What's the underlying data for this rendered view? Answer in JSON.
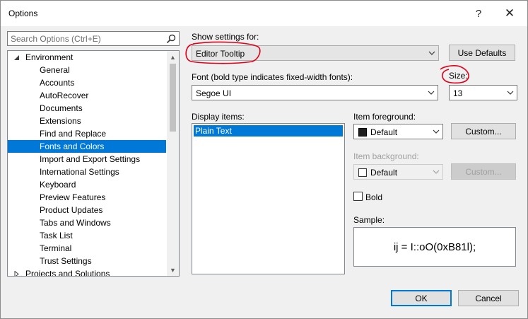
{
  "window": {
    "title": "Options",
    "help_glyph": "?",
    "close_glyph": "✕"
  },
  "search": {
    "placeholder": "Search Options (Ctrl+E)"
  },
  "tree": {
    "root_label": "Environment",
    "children": [
      "General",
      "Accounts",
      "AutoRecover",
      "Documents",
      "Extensions",
      "Find and Replace",
      "Fonts and Colors",
      "Import and Export Settings",
      "International Settings",
      "Keyboard",
      "Preview Features",
      "Product Updates",
      "Tabs and Windows",
      "Task List",
      "Terminal",
      "Trust Settings"
    ],
    "selected": "Fonts and Colors",
    "next_root_label": "Projects and Solutions"
  },
  "settings": {
    "show_settings_label": "Show settings for:",
    "show_settings_value": "Editor Tooltip",
    "use_defaults_label": "Use Defaults",
    "font_label": "Font (bold type indicates fixed-width fonts):",
    "font_value": "Segoe UI",
    "size_label": "Size:",
    "size_value": "13",
    "display_items_label": "Display items:",
    "display_items": [
      "Plain Text"
    ],
    "item_foreground_label": "Item foreground:",
    "item_foreground_value": "Default",
    "item_foreground_color": "#1e1e1e",
    "custom_fg_label": "Custom...",
    "item_background_label": "Item background:",
    "item_background_value": "Default",
    "item_background_color": "#ffffff",
    "custom_bg_label": "Custom...",
    "bold_label": "Bold",
    "bold_checked": false,
    "sample_label": "Sample:",
    "sample_text": "ij = I::oO(0xB81l);"
  },
  "footer": {
    "ok_label": "OK",
    "cancel_label": "Cancel"
  },
  "colors": {
    "selection": "#0078d7",
    "annotation": "#e0001a"
  }
}
